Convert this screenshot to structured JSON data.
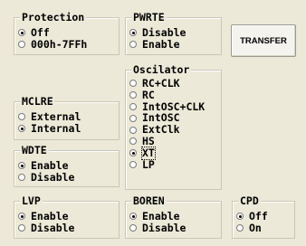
{
  "protection": {
    "title": "Protection",
    "options": [
      "Off",
      "000h-7FFh"
    ],
    "selected": 0
  },
  "pwrte": {
    "title": "PWRTE",
    "options": [
      "Disable",
      "Enable"
    ],
    "selected": 0
  },
  "transfer_label": "TRANSFER",
  "mclre": {
    "title": "MCLRE",
    "options": [
      "External",
      "Internal"
    ],
    "selected": 1
  },
  "oscilator": {
    "title": "Oscilator",
    "options": [
      "RC+CLK",
      "RC",
      "IntOSC+CLK",
      "IntOSC",
      "ExtClk",
      "HS",
      "XT",
      "LP"
    ],
    "selected": 6
  },
  "wdte": {
    "title": "WDTE",
    "options": [
      "Enable",
      "Disable"
    ],
    "selected": 0
  },
  "lvp": {
    "title": "LVP",
    "options": [
      "Enable",
      "Disable"
    ],
    "selected": 0
  },
  "boren": {
    "title": "BOREN",
    "options": [
      "Enable",
      "Disable"
    ],
    "selected": 0
  },
  "cpd": {
    "title": "CPD",
    "options": [
      "Off",
      "On"
    ],
    "selected": 0
  }
}
